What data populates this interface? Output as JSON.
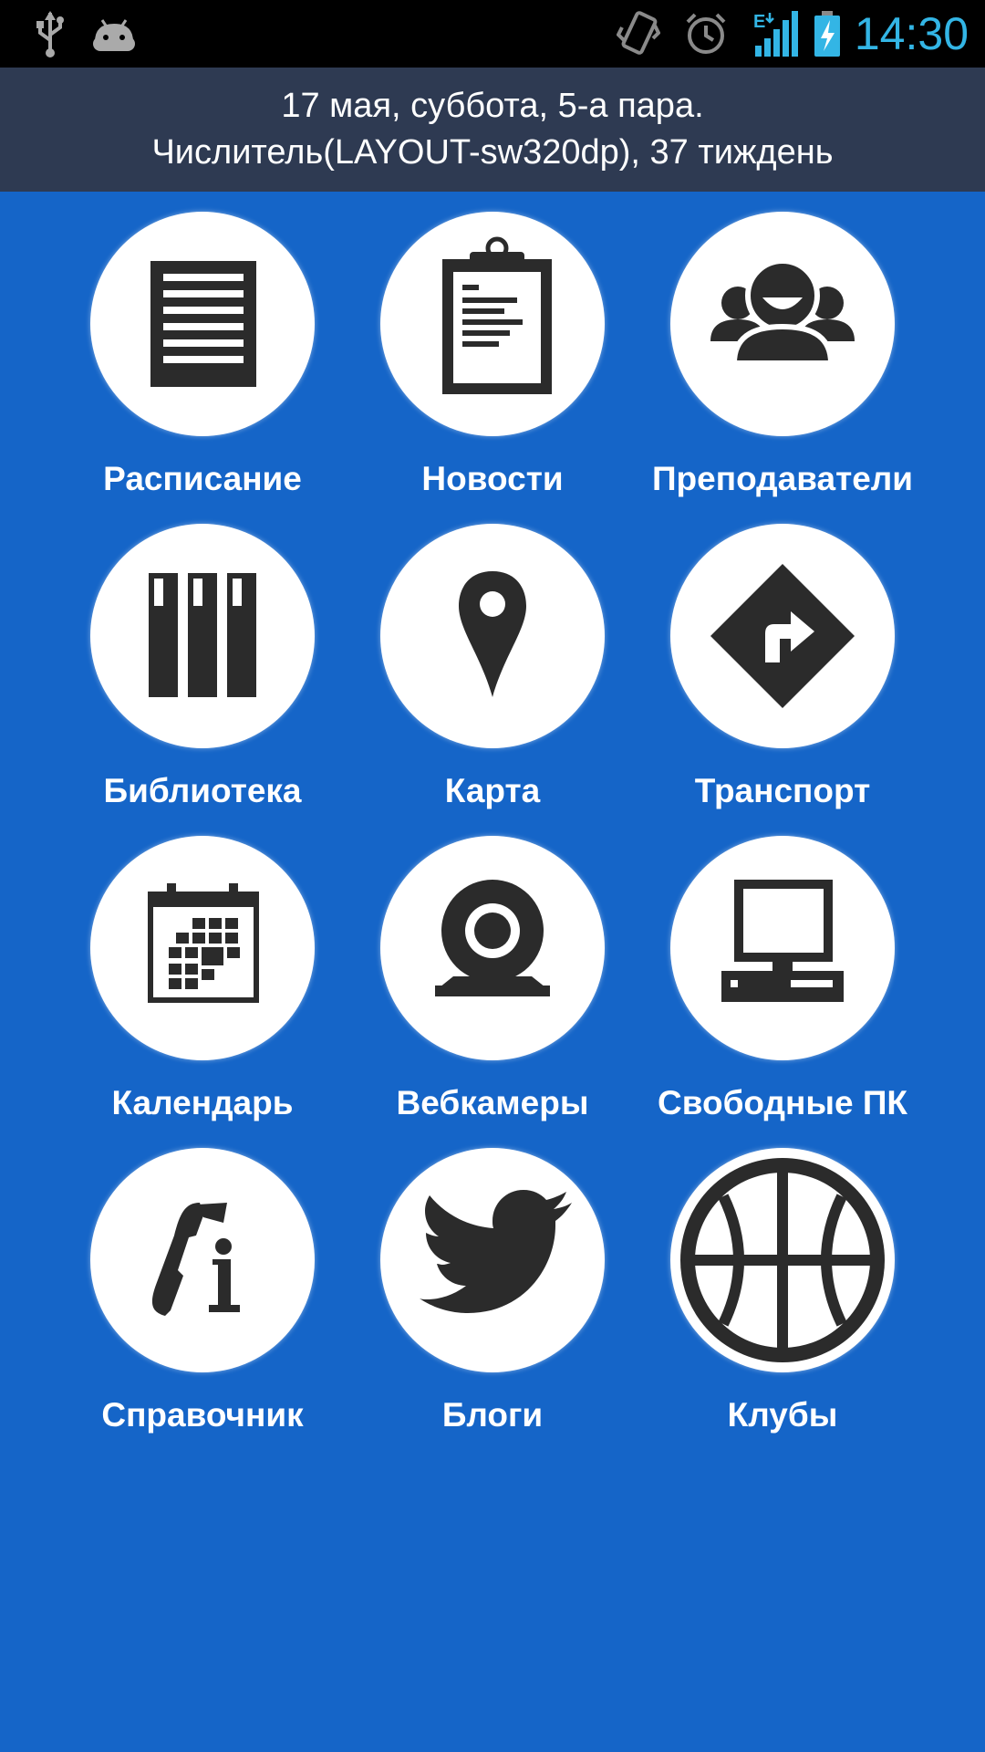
{
  "status_bar": {
    "time": "14:30",
    "network_type": "E",
    "time_color": "#33b5e5",
    "icons": [
      "usb-icon",
      "android-debug-icon",
      "vibrate-icon",
      "alarm-icon",
      "signal-icon",
      "battery-charging-icon"
    ]
  },
  "header": {
    "line1": "17 мая, суббота, 5-а пара.",
    "line2": "Числитель(LAYOUT-sw320dp), 37 тиждень",
    "background": "#2e3a52"
  },
  "theme": {
    "background": "#1565c8",
    "icon_color": "#2b2b2b"
  },
  "tiles": [
    {
      "label": "Расписание",
      "icon": "document-icon"
    },
    {
      "label": "Новости",
      "icon": "clipboard-icon"
    },
    {
      "label": "Преподаватели",
      "icon": "people-icon"
    },
    {
      "label": "Библиотека",
      "icon": "books-icon"
    },
    {
      "label": "Карта",
      "icon": "map-pin-icon"
    },
    {
      "label": "Транспорт",
      "icon": "direction-sign-icon"
    },
    {
      "label": "Календарь",
      "icon": "calendar-icon"
    },
    {
      "label": "Вебкамеры",
      "icon": "webcam-icon"
    },
    {
      "label": "Свободные ПК",
      "icon": "computer-icon"
    },
    {
      "label": "Справочник",
      "icon": "phone-info-icon"
    },
    {
      "label": "Блоги",
      "icon": "twitter-bird-icon"
    },
    {
      "label": "Клубы",
      "icon": "basketball-icon"
    }
  ]
}
